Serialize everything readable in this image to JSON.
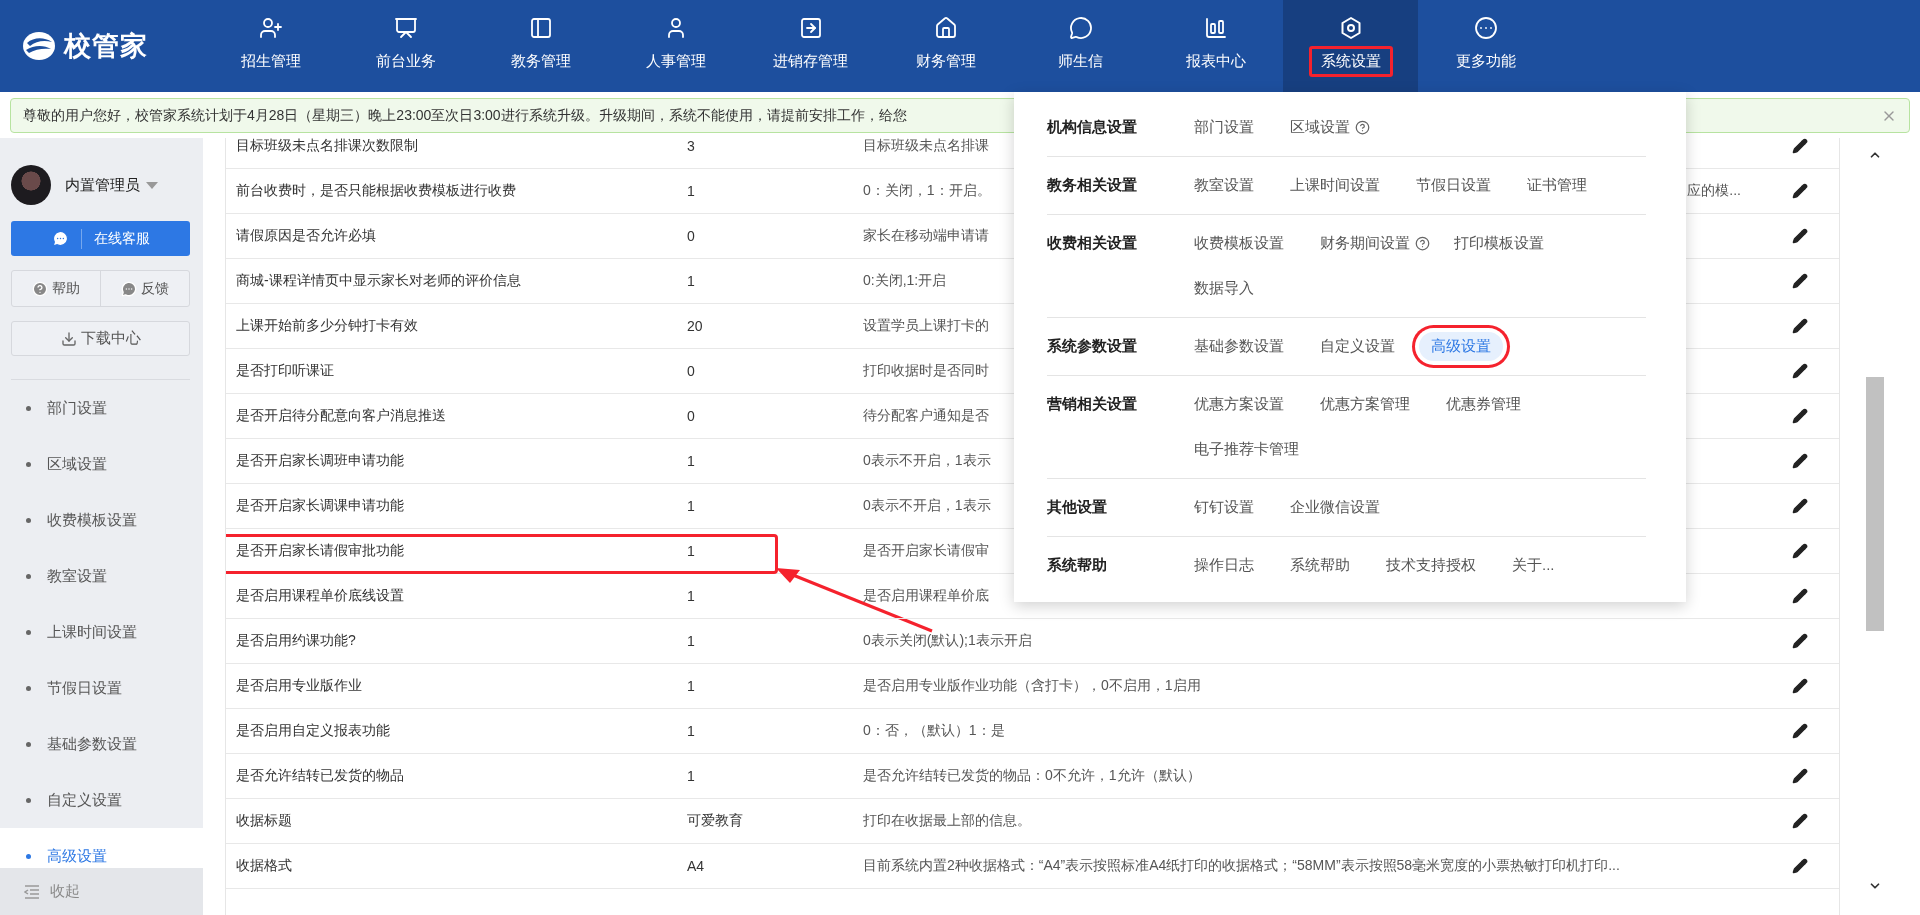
{
  "logo": {
    "text": "校管家"
  },
  "nav": [
    {
      "label": "招生管理",
      "selected": false,
      "highlighted": false
    },
    {
      "label": "前台业务",
      "selected": false,
      "highlighted": false
    },
    {
      "label": "教务管理",
      "selected": false,
      "highlighted": false
    },
    {
      "label": "人事管理",
      "selected": false,
      "highlighted": false
    },
    {
      "label": "进销存管理",
      "selected": false,
      "highlighted": false
    },
    {
      "label": "财务管理",
      "selected": false,
      "highlighted": false
    },
    {
      "label": "师生信",
      "selected": false,
      "highlighted": false
    },
    {
      "label": "报表中心",
      "selected": false,
      "highlighted": false
    },
    {
      "label": "系统设置",
      "selected": true,
      "highlighted": true
    },
    {
      "label": "更多功能",
      "selected": false,
      "highlighted": false
    }
  ],
  "notice": {
    "text": "尊敬的用户您好，校管家系统计划于4月28日（星期三）晚上23:00至次日3:00进行系统升级。升级期间，系统不能使用，请提前安排工作，给您"
  },
  "sidebar": {
    "user": "内置管理员",
    "service_button": "在线客服",
    "help_button": "帮助",
    "feedback_button": "反馈",
    "download_button": "下载中心",
    "items": [
      {
        "label": "部门设置",
        "selected": false
      },
      {
        "label": "区域设置",
        "selected": false
      },
      {
        "label": "收费模板设置",
        "selected": false
      },
      {
        "label": "教室设置",
        "selected": false
      },
      {
        "label": "上课时间设置",
        "selected": false
      },
      {
        "label": "节假日设置",
        "selected": false
      },
      {
        "label": "基础参数设置",
        "selected": false
      },
      {
        "label": "自定义设置",
        "selected": false
      },
      {
        "label": "高级设置",
        "selected": true
      }
    ],
    "collapse": "收起"
  },
  "table": {
    "rows": [
      {
        "name": "目标班级未点名排课次数限制",
        "value": "3",
        "description": "目标班级未点名排课",
        "highlighted": false
      },
      {
        "name": "前台收费时，是否只能根据收费模板进行收费",
        "value": "1",
        "description": "0：关闭，1：开启。",
        "description_tail": "应的模...",
        "highlighted": false
      },
      {
        "name": "请假原因是否允许必填",
        "value": "0",
        "description": "家长在移动端申请请",
        "highlighted": false
      },
      {
        "name": "商城-课程详情页中显示家长对老师的评价信息",
        "value": "1",
        "description": "0:关闭,1:开启",
        "highlighted": false
      },
      {
        "name": "上课开始前多少分钟打卡有效",
        "value": "20",
        "description": "设置学员上课打卡的",
        "highlighted": false
      },
      {
        "name": "是否打印听课证",
        "value": "0",
        "description": "打印收据时是否同时",
        "highlighted": false
      },
      {
        "name": "是否开启待分配意向客户消息推送",
        "value": "0",
        "description": "待分配客户通知是否",
        "highlighted": false
      },
      {
        "name": "是否开启家长调班申请功能",
        "value": "1",
        "description": "0表示不开启，1表示",
        "highlighted": false
      },
      {
        "name": "是否开启家长调课申请功能",
        "value": "1",
        "description": "0表示不开启，1表示",
        "highlighted": false
      },
      {
        "name": "是否开启家长请假审批功能",
        "value": "1",
        "description": "是否开启家长请假审",
        "highlighted": true
      },
      {
        "name": "是否启用课程单价底线设置",
        "value": "1",
        "description": "是否启用课程单价底",
        "highlighted": false
      },
      {
        "name": "是否启用约课功能?",
        "value": "1",
        "description": "0表示关闭(默认);1表示开启",
        "highlighted": false
      },
      {
        "name": "是否启用专业版作业",
        "value": "1",
        "description": "是否启用专业版作业功能（含打卡），0不启用，1启用",
        "highlighted": false
      },
      {
        "name": "是否启用自定义报表功能",
        "value": "1",
        "description": "0：否，（默认）1：是",
        "highlighted": false
      },
      {
        "name": "是否允许结转已发货的物品",
        "value": "1",
        "description": "是否允许结转已发货的物品：0不允许，1允许（默认）",
        "highlighted": false
      },
      {
        "name": "收据标题",
        "value": "可爱教育",
        "description": "打印在收据最上部的信息。",
        "highlighted": false
      },
      {
        "name": "收据格式",
        "value": "A4",
        "description": "目前系统内置2种收据格式：“A4”表示按照标准A4纸打印的收据格式；“58MM”表示按照58毫米宽度的小票热敏打印机打印...",
        "highlighted": false
      }
    ]
  },
  "settings_menu": {
    "groups": [
      {
        "title": "机构信息设置",
        "items": [
          {
            "label": "部门设置",
            "help": false,
            "selected": false,
            "highlighted": false
          },
          {
            "label": "区域设置",
            "help": true,
            "selected": false,
            "highlighted": false
          }
        ]
      },
      {
        "title": "教务相关设置",
        "items": [
          {
            "label": "教室设置",
            "help": false,
            "selected": false,
            "highlighted": false
          },
          {
            "label": "上课时间设置",
            "help": false,
            "selected": false,
            "highlighted": false
          },
          {
            "label": "节假日设置",
            "help": false,
            "selected": false,
            "highlighted": false
          },
          {
            "label": "证书管理",
            "help": false,
            "selected": false,
            "highlighted": false
          }
        ]
      },
      {
        "title": "收费相关设置",
        "items": [
          {
            "label": "收费模板设置",
            "help": false,
            "selected": false,
            "highlighted": false
          },
          {
            "label": "财务期间设置",
            "help": true,
            "selected": false,
            "highlighted": false
          },
          {
            "label": "打印模板设置",
            "help": false,
            "selected": false,
            "highlighted": false
          },
          {
            "label": "数据导入",
            "help": false,
            "selected": false,
            "highlighted": false
          }
        ]
      },
      {
        "title": "系统参数设置",
        "items": [
          {
            "label": "基础参数设置",
            "help": false,
            "selected": false,
            "highlighted": false
          },
          {
            "label": "自定义设置",
            "help": false,
            "selected": false,
            "highlighted": false
          },
          {
            "label": "高级设置",
            "help": false,
            "selected": true,
            "highlighted": true
          }
        ]
      },
      {
        "title": "营销相关设置",
        "items": [
          {
            "label": "优惠方案设置",
            "help": false,
            "selected": false,
            "highlighted": false
          },
          {
            "label": "优惠方案管理",
            "help": false,
            "selected": false,
            "highlighted": false
          },
          {
            "label": "优惠券管理",
            "help": false,
            "selected": false,
            "highlighted": false
          },
          {
            "label": "电子推荐卡管理",
            "help": false,
            "selected": false,
            "highlighted": false
          }
        ]
      },
      {
        "title": "其他设置",
        "items": [
          {
            "label": "钉钉设置",
            "help": false,
            "selected": false,
            "highlighted": false
          },
          {
            "label": "企业微信设置",
            "help": false,
            "selected": false,
            "highlighted": false
          }
        ]
      },
      {
        "title": "系统帮助",
        "items": [
          {
            "label": "操作日志",
            "help": false,
            "selected": false,
            "highlighted": false
          },
          {
            "label": "系统帮助",
            "help": false,
            "selected": false,
            "highlighted": false
          },
          {
            "label": "技术支持授权",
            "help": false,
            "selected": false,
            "highlighted": false
          },
          {
            "label": "关于...",
            "help": false,
            "selected": false,
            "highlighted": false
          }
        ]
      }
    ]
  }
}
